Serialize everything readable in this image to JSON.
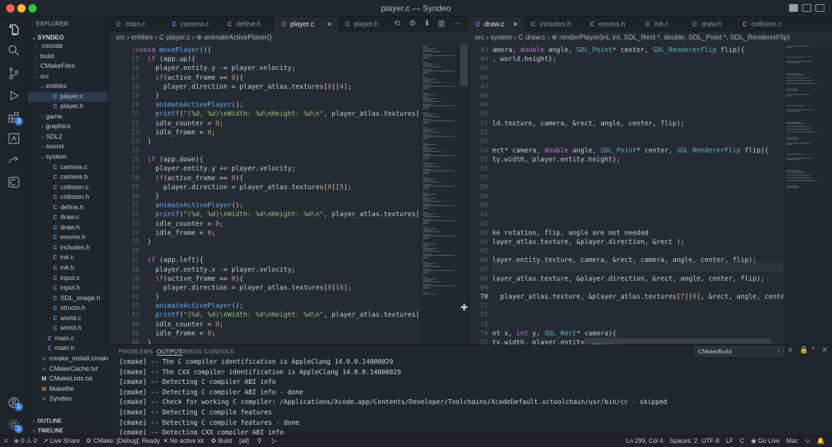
{
  "window": {
    "title": "player.c — Syndeo"
  },
  "sidebar": {
    "header": "EXPLORER",
    "root": "SYNDEO",
    "tree": [
      {
        "label": ".vscode",
        "depth": 1,
        "kind": "folder",
        "open": false
      },
      {
        "label": "build",
        "depth": 1,
        "kind": "folder",
        "open": false
      },
      {
        "label": "CMakeFiles",
        "depth": 1,
        "kind": "folder",
        "open": false
      },
      {
        "label": "src",
        "depth": 1,
        "kind": "folder",
        "open": true
      },
      {
        "label": "entities",
        "depth": 2,
        "kind": "folder",
        "open": true
      },
      {
        "label": "player.c",
        "depth": 3,
        "kind": "c",
        "selected": true
      },
      {
        "label": "player.h",
        "depth": 3,
        "kind": "c"
      },
      {
        "label": "game",
        "depth": 2,
        "kind": "folder",
        "open": false
      },
      {
        "label": "graphics",
        "depth": 2,
        "kind": "folder",
        "open": false
      },
      {
        "label": "SDL2",
        "depth": 2,
        "kind": "folder",
        "open": false
      },
      {
        "label": "sound",
        "depth": 2,
        "kind": "folder",
        "open": false
      },
      {
        "label": "system",
        "depth": 2,
        "kind": "folder",
        "open": true
      },
      {
        "label": "camera.c",
        "depth": 3,
        "kind": "c"
      },
      {
        "label": "camera.h",
        "depth": 3,
        "kind": "c"
      },
      {
        "label": "collision.c",
        "depth": 3,
        "kind": "c"
      },
      {
        "label": "collision.h",
        "depth": 3,
        "kind": "c"
      },
      {
        "label": "define.h",
        "depth": 3,
        "kind": "c"
      },
      {
        "label": "draw.c",
        "depth": 3,
        "kind": "c"
      },
      {
        "label": "draw.h",
        "depth": 3,
        "kind": "c"
      },
      {
        "label": "enums.h",
        "depth": 3,
        "kind": "c"
      },
      {
        "label": "includes.h",
        "depth": 3,
        "kind": "c"
      },
      {
        "label": "init.c",
        "depth": 3,
        "kind": "c"
      },
      {
        "label": "init.h",
        "depth": 3,
        "kind": "c"
      },
      {
        "label": "input.c",
        "depth": 3,
        "kind": "c"
      },
      {
        "label": "input.h",
        "depth": 3,
        "kind": "c"
      },
      {
        "label": "SDL_image.h",
        "depth": 3,
        "kind": "c"
      },
      {
        "label": "structs.h",
        "depth": 3,
        "kind": "c"
      },
      {
        "label": "world.c",
        "depth": 3,
        "kind": "c"
      },
      {
        "label": "world.h",
        "depth": 3,
        "kind": "c"
      },
      {
        "label": "main.c",
        "depth": 2,
        "kind": "c"
      },
      {
        "label": "main.h",
        "depth": 2,
        "kind": "c"
      },
      {
        "label": "cmake_install.cmake",
        "depth": 1,
        "kind": "txt"
      },
      {
        "label": "CMakeCache.txt",
        "depth": 1,
        "kind": "txt"
      },
      {
        "label": "CMakeLists.txt",
        "depth": 1,
        "kind": "m"
      },
      {
        "label": "Makefile",
        "depth": 1,
        "kind": "mk"
      },
      {
        "label": "Syndeo",
        "depth": 1,
        "kind": "txt"
      }
    ],
    "outline": "OUTLINE",
    "timeline": "TIMELINE"
  },
  "left_tabs": [
    "main.c",
    "camera.c",
    "define.h",
    "player.c",
    "player.h"
  ],
  "left_tab_active": "player.c",
  "right_tabs": [
    "draw.c",
    "includes.h",
    "enums.h",
    "init.c",
    "draw.h",
    "collision.c"
  ],
  "right_tab_active": "draw.c",
  "tab_letter": "C",
  "left_breadcrumb": "src  ›  entities  ›  C  player.c  ›  ⊕ animateActivePlayer()",
  "right_breadcrumb": "src  ›  system  ›  C  draw.c  ›  ⊕ renderPlayer(int, int, SDL_Rect *, double, SDL_Point *, SDL_RendererFlip)",
  "left_code": {
    "start": 14,
    "lines": [
      "void movePlayer(){",
      "  if (app.up){",
      "    player.entity.y -= player.velocity;",
      "    if(active_frame == 0){",
      "      player.direction = player_atlas.textures[0][4];",
      "    }",
      "    animateActivePlayer();",
      "    printf(\"(%d, %d)\\nWidth: %d\\nHeight: %d\\n\", player_atlas.textures[0][0].x, player",
      "    idle_counter = 0;",
      "    idle_frame = 0;",
      "  }",
      "",
      "  if (app.down){",
      "    player.entity.y += player.velocity;",
      "    if(active_frame == 0){",
      "      player.direction = player_atlas.textures[0][5];",
      "    }",
      "    animateActivePlayer();",
      "    printf(\"(%d, %d)\\nWidth: %d\\nHeight: %d\\n\", player_atlas.textures[0][1].x, player",
      "    idle_counter = 0;",
      "    idle_frame = 0;",
      "  }",
      "",
      "  if (app.left){",
      "    player.entity.x -= player.velocity;",
      "    if(active_frame == 0){",
      "      player.direction = player_atlas.textures[0][6];",
      "    }",
      "    animateActivePlayer();",
      "    printf(\"(%d, %d)\\nWidth: %d\\nHeight: %d\\n\", player_atlas.textures[0][2].x, player",
      "    idle_counter = 0;",
      "    idle_frame = 0;",
      "  }",
      "",
      "  if (app.right){",
      "    player.entity.x += player.velocity;"
    ]
  },
  "right_code": {
    "start": 43,
    "current_line": 70,
    "lines": [
      "amera, double angle, SDL_Point* center, SDL_RendererFlip flip){",
      ", world.height};",
      "",
      "",
      "",
      "",
      "",
      "",
      "ld.texture, camera, &rect, angle, center, flip);",
      "",
      "",
      "ect* camera, double angle, SDL_Point* center, SDL_RendererFlip flip){",
      "ty.width, player.entity.height};",
      "",
      "",
      "",
      "",
      "",
      "",
      "",
      "ke rotation, flip, angle are not needed",
      "layer_atlas.texture, &player.direction, &rect );",
      "",
      "layer.entity.texture, camera, &rect, camera, angle, center, flip);",
      "",
      "layer_atlas.texture, &player.direction, &rect, angle, center, flip);",
      "",
      "  player_atlas.texture, &player_atlas.textures[7][0], &rect, angle, center, flip);",
      "",
      "",
      "",
      "nt x, int y, SDL_Rect* camera){",
      "ty.width, player.entity.height};",
      "",
      ""
    ]
  },
  "panel": {
    "tabs": [
      "PROBLEMS",
      "OUTPUT",
      "DEBUG CONSOLE"
    ],
    "active_tab": "OUTPUT",
    "channel": "CMake/Build",
    "output": [
      "[cmake] -- The C compiler identification is AppleClang 14.0.0.14000029",
      "[cmake] -- The CXX compiler identification is AppleClang 14.0.0.14000029",
      "[cmake] -- Detecting C compiler ABI info",
      "[cmake] -- Detecting C compiler ABI info - done",
      "[cmake] -- Check for working C compiler: /Applications/Xcode.app/Contents/Developer/Toolchains/XcodeDefault.xctoolchain/usr/bin/cc - skipped",
      "[cmake] -- Detecting C compile features",
      "[cmake] -- Detecting C compile features - done",
      "[cmake] -- Detecting CXX compiler ABI info",
      "[cmake] -- Detecting CXX compiler ABI info - done",
      "[cmake] -- Check for working CXX compiler: /Applications/Xcode.app/Contents/Developer/Toolchains/XcodeDefault.xctoolchain/usr/bin/c++ - skipped"
    ]
  },
  "status": {
    "errors": "0",
    "warnings": "0",
    "live_share": "Live Share",
    "cmake": "CMake: [Debug]: Ready",
    "kit": "No active kit",
    "build": "Build",
    "target": "[all]",
    "position": "Ln 299, Col 4",
    "spaces": "Spaces: 2",
    "encoding": "UTF-8",
    "eol": "LF",
    "language": "C",
    "go_live": "Go Live",
    "platform": "Mac"
  },
  "activity_badges": {
    "extensions": "3",
    "accounts": "1",
    "settings": "1"
  },
  "colors": {
    "keyword": "#c678dd",
    "function": "#61afef",
    "string": "#98c379",
    "number": "#d19a66",
    "type": "#56b6c2",
    "comment": "#6b7280"
  }
}
